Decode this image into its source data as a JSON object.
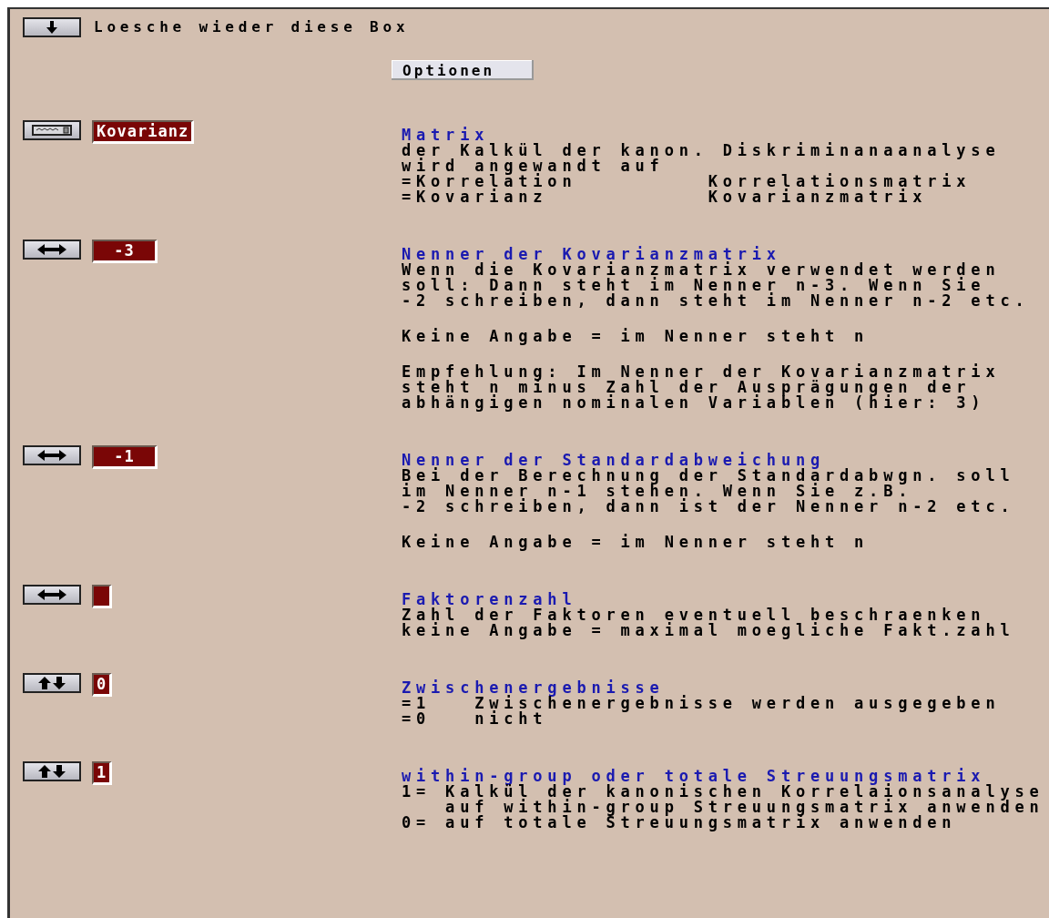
{
  "delete_box": {
    "label": "Loesche wieder diese Box"
  },
  "options_button": "Optionen",
  "settings": [
    {
      "kind": "select",
      "value": "Kovarianz",
      "title": "Matrix",
      "paragraphs": [
        [
          "der Kalkül der kanon. Diskriminanaanalyse",
          "wird angewandt auf",
          "=Korrelation         Korrelationsmatrix",
          "=Kovarianz           Kovarianzmatrix"
        ]
      ]
    },
    {
      "kind": "horizontal",
      "value": "-3",
      "title": "Nenner der Kovarianzmatrix",
      "paragraphs": [
        [
          "Wenn die Kovarianzmatrix verwendet werden",
          "soll: Dann steht im Nenner n-3. Wenn Sie",
          "-2 schreiben, dann steht im Nenner n-2 etc."
        ],
        [
          "Keine Angabe = im Nenner steht n"
        ],
        [
          "Empfehlung: Im Nenner der Kovarianzmatrix",
          "steht n minus Zahl der Ausprägungen der",
          "abhängigen nominalen Variablen (hier: 3)"
        ]
      ]
    },
    {
      "kind": "horizontal",
      "value": "-1",
      "title": "Nenner der Standardabweichung",
      "paragraphs": [
        [
          "Bei der Berechnung der Standardabwgn. soll",
          "im Nenner n-1 stehen. Wenn Sie z.B.",
          "-2 schreiben, dann ist der Nenner n-2 etc."
        ],
        [
          "Keine Angabe = im Nenner steht n"
        ]
      ]
    },
    {
      "kind": "horizontal",
      "title": "Faktorenzahl",
      "paragraphs": [
        [
          "Zahl der Faktoren eventuell beschraenken",
          "keine Angabe = maximal moegliche Fakt.zahl"
        ]
      ]
    },
    {
      "kind": "vertical",
      "value": "0",
      "title": "Zwischenergebnisse",
      "paragraphs": [
        [
          "=1   Zwischenergebnisse werden ausgegeben",
          "=0   nicht"
        ]
      ]
    },
    {
      "kind": "vertical",
      "value": "1",
      "title": "within-group oder totale Streuungsmatrix",
      "paragraphs": [
        [
          "1= Kalkül der kanonischen Korrelaionsanalyse",
          "   auf within-group Streuungsmatrix anwenden",
          "0= auf totale Streuungsmatrix anwenden"
        ]
      ]
    }
  ]
}
